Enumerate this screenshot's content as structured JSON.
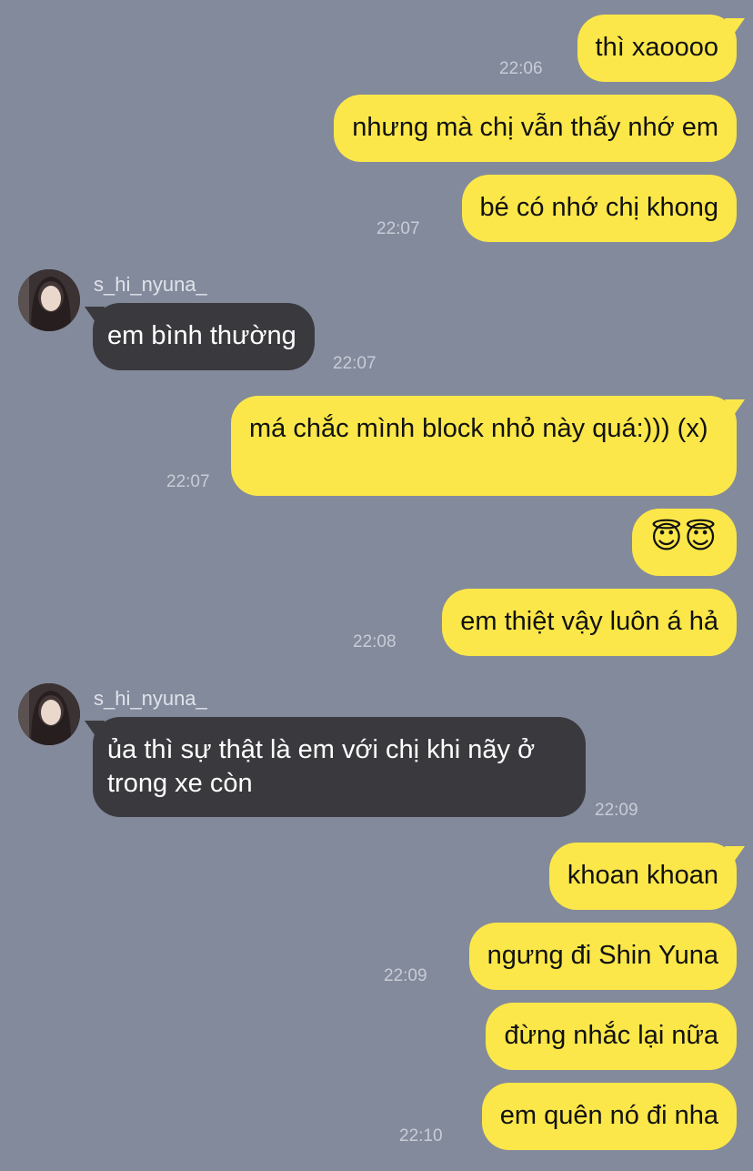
{
  "colors": {
    "background": "#838a9c",
    "outgoing_bubble": "#fbe749",
    "incoming_bubble": "#3a3a3e",
    "timestamp": "#c9ccd6"
  },
  "messages": [
    {
      "dir": "out",
      "text": "thì xaoooo",
      "time": "22:06"
    },
    {
      "dir": "out",
      "text": "nhưng mà chị vẫn thấy nhớ em",
      "time": ""
    },
    {
      "dir": "out",
      "text": "bé có nhớ chị khong",
      "time": "22:07"
    },
    {
      "dir": "in",
      "sender": "s_hi_nyuna_",
      "avatar": "avatar-icon",
      "text": "em bình thường",
      "time": "22:07"
    },
    {
      "dir": "out",
      "text": "má chắc mình block nhỏ này quá:))) (x)",
      "time": "22:07"
    },
    {
      "dir": "out",
      "text": "😇😇",
      "time": ""
    },
    {
      "dir": "out",
      "text": "em thiệt vậy luôn á hả",
      "time": "22:08"
    },
    {
      "dir": "in",
      "sender": "s_hi_nyuna_",
      "avatar": "avatar-icon",
      "text": "ủa thì sự thật là em với chị khi nãy ở trong xe còn",
      "time": "22:09"
    },
    {
      "dir": "out",
      "text": "khoan khoan",
      "time": ""
    },
    {
      "dir": "out",
      "text": "ngưng đi Shin Yuna",
      "time": "22:09"
    },
    {
      "dir": "out",
      "text": "đừng nhắc lại nữa",
      "time": ""
    },
    {
      "dir": "out",
      "text": "em quên nó đi nha",
      "time": "22:10"
    }
  ]
}
